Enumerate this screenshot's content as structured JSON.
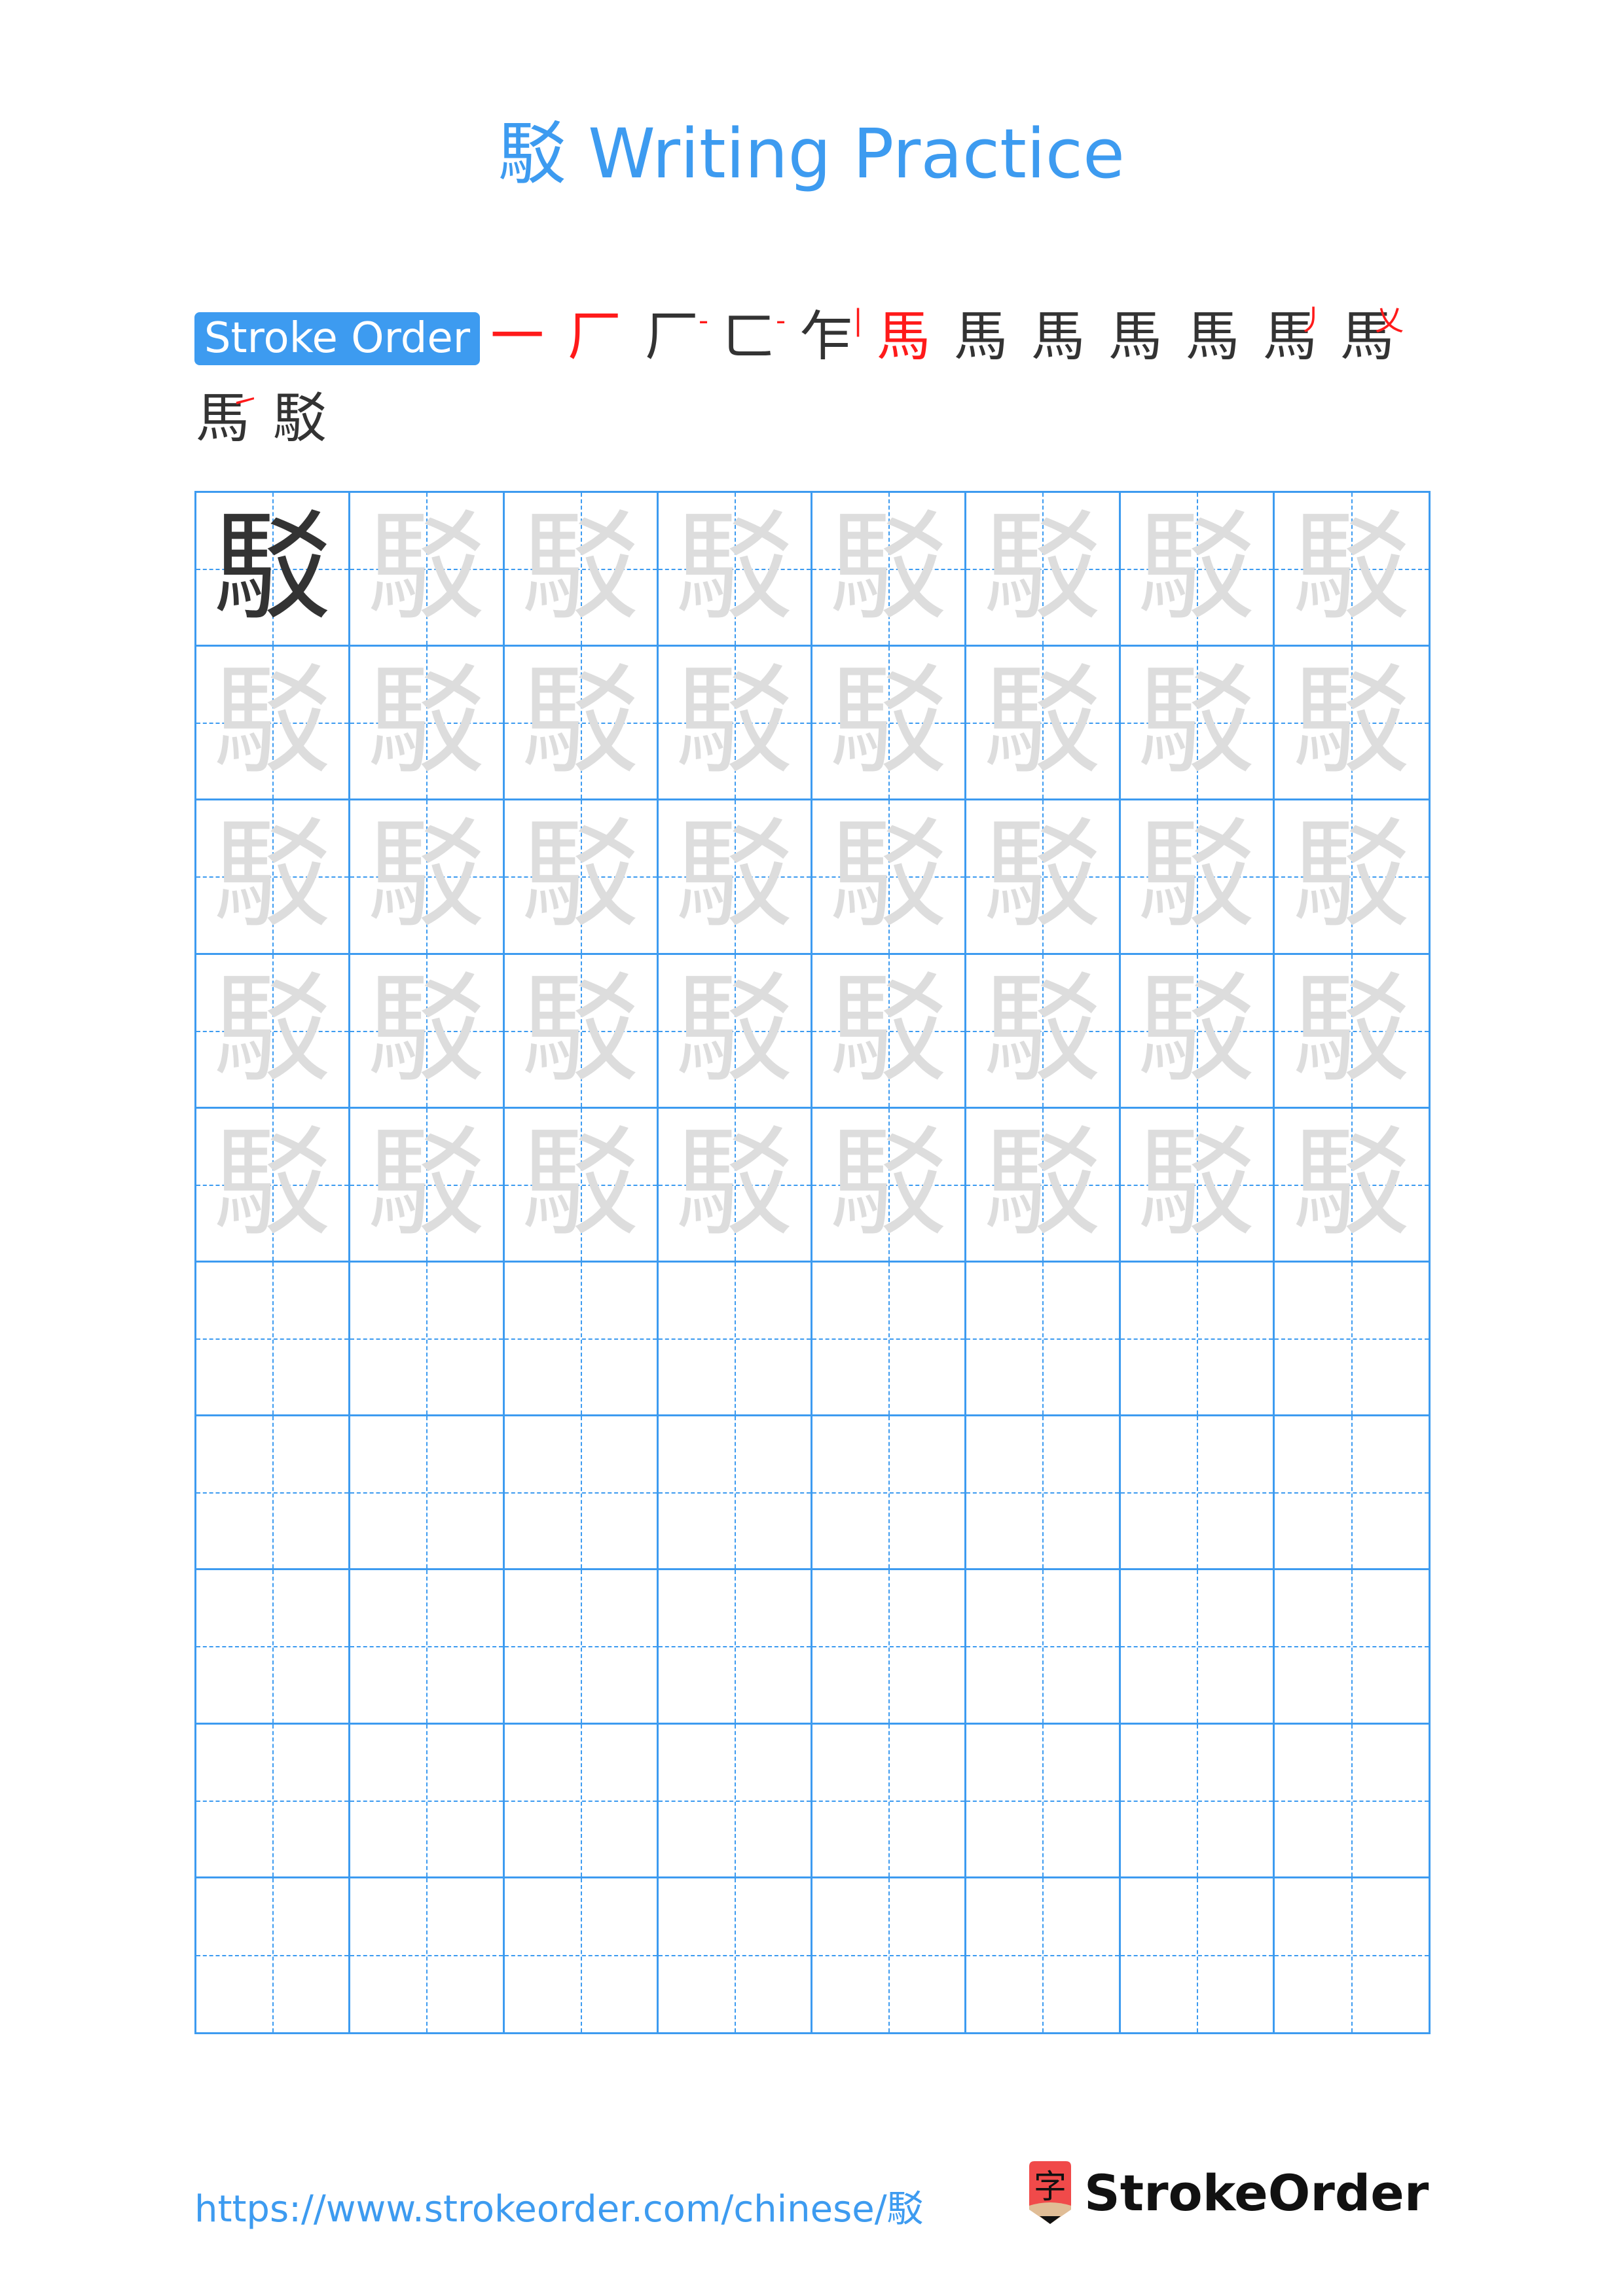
{
  "page": {
    "title": "駁 Writing Practice",
    "character": "駁",
    "colors": {
      "accent": "#3d9bf0",
      "model": "#333333",
      "trace": "#dddddd",
      "stroke_highlight": "#ff1a1a",
      "logo_red": "#f04a4a",
      "logo_tan": "#e0bd96"
    }
  },
  "stroke_order": {
    "label": "Stroke Order",
    "total_strokes": 14,
    "steps": [
      {
        "n": 1,
        "base": "",
        "new": "一"
      },
      {
        "n": 2,
        "base": "",
        "new": "厂"
      },
      {
        "n": 3,
        "base": "厂",
        "new": "-"
      },
      {
        "n": 4,
        "base": "ㄈ",
        "new": "-"
      },
      {
        "n": 5,
        "base": "乍",
        "new": "|"
      },
      {
        "n": 6,
        "base": "",
        "new": "馬"
      },
      {
        "n": 7,
        "base": "馬",
        "new": ""
      },
      {
        "n": 8,
        "base": "馬",
        "new": ""
      },
      {
        "n": 9,
        "base": "馬",
        "new": ""
      },
      {
        "n": 10,
        "base": "馬",
        "new": ""
      },
      {
        "n": 11,
        "base": "馬",
        "new": "丿"
      },
      {
        "n": 12,
        "base": "馬",
        "new": "乂"
      },
      {
        "n": 13,
        "base": "馬",
        "new": "㇀"
      },
      {
        "n": 14,
        "base": "駁",
        "new": ""
      }
    ]
  },
  "grid": {
    "rows": 10,
    "cols": 8,
    "filled_rows": 5,
    "model_char": "駁",
    "trace_char": "駁"
  },
  "footer": {
    "url": "https://www.strokeorder.com/chinese/駁",
    "logo_text": "StrokeOrder",
    "logo_icon_glyph": "字"
  }
}
